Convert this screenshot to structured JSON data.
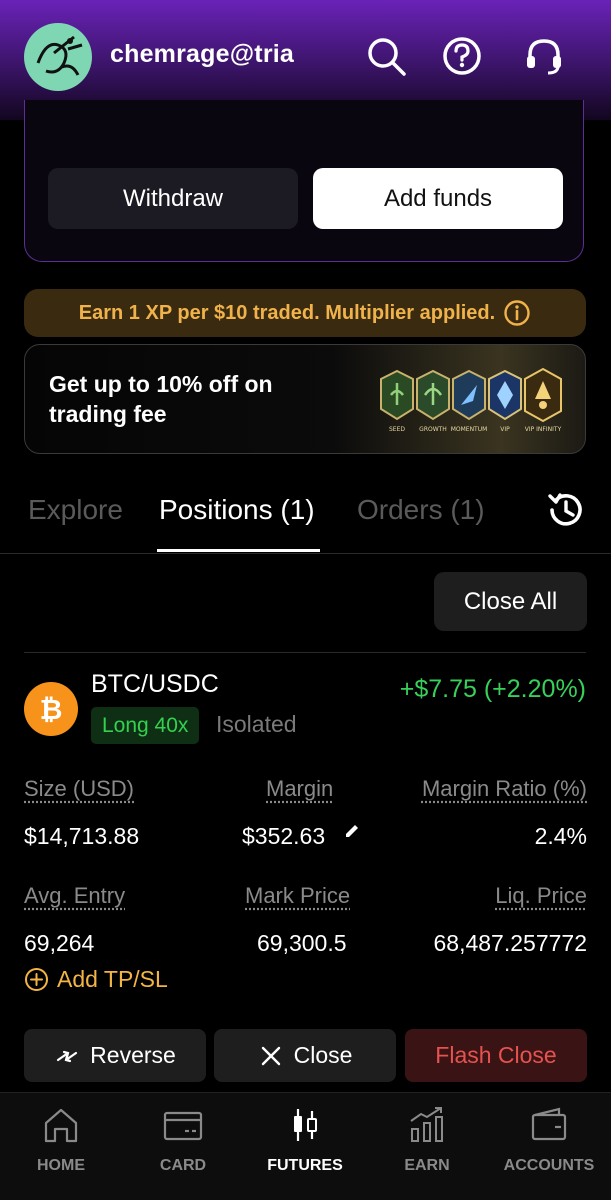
{
  "header": {
    "username": "chemrage@tria"
  },
  "funds": {
    "withdraw_label": "Withdraw",
    "add_funds_label": "Add funds"
  },
  "xp_banner": {
    "text": "Earn 1 XP per $10 traded. Multiplier applied."
  },
  "promo": {
    "line1": "Get up to 10% off on",
    "line2": "trading fee",
    "badges": [
      "SEED",
      "GROWTH",
      "MOMENTUM",
      "VIP",
      "VIP INFINITY"
    ]
  },
  "tabs": [
    {
      "label": "Explore",
      "active": false
    },
    {
      "label": "Positions (1)",
      "active": true
    },
    {
      "label": "Orders (1)",
      "active": false
    }
  ],
  "close_all_label": "Close All",
  "position": {
    "pair": "BTC/USDC",
    "side_leverage": "Long 40x",
    "margin_mode": "Isolated",
    "pnl": "+$7.75 (+2.20%)",
    "size_label": "Size (USD)",
    "size_value": "$14,713.88",
    "margin_label": "Margin",
    "margin_value": "$352.63",
    "margin_ratio_label": "Margin Ratio (%)",
    "margin_ratio_value": "2.4%",
    "avg_entry_label": "Avg. Entry",
    "avg_entry_value": "69,264",
    "mark_price_label": "Mark Price",
    "mark_price_value": "69,300.5",
    "liq_price_label": "Liq. Price",
    "liq_price_value": "68,487.257772",
    "add_tpsl_label": "Add TP/SL",
    "reverse_label": "Reverse",
    "close_label": "Close",
    "flash_close_label": "Flash Close"
  },
  "nav": [
    {
      "label": "HOME",
      "icon": "home-icon"
    },
    {
      "label": "CARD",
      "icon": "card-icon"
    },
    {
      "label": "FUTURES",
      "icon": "candlestick-icon",
      "active": true
    },
    {
      "label": "EARN",
      "icon": "bar-chart-icon"
    },
    {
      "label": "ACCOUNTS",
      "icon": "wallet-icon"
    }
  ],
  "colors": {
    "accent_purple": "#6a22b8",
    "profit_green": "#37d05b",
    "warning_gold": "#f0b24a",
    "danger_red": "#e5524f"
  }
}
